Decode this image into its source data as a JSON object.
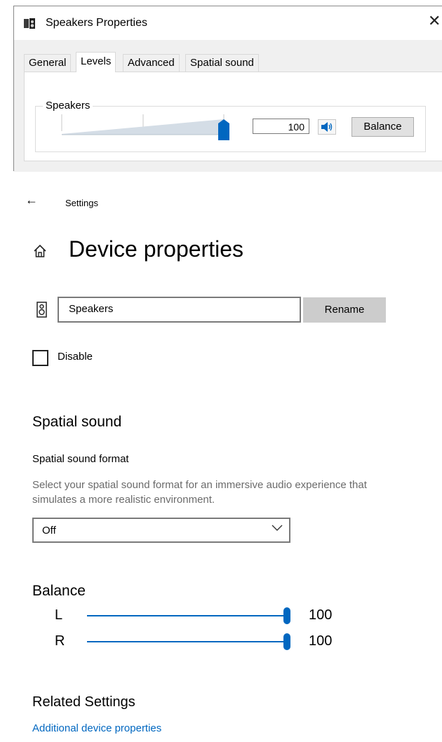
{
  "dialog": {
    "title": "Speakers Properties",
    "close_glyph": "✕",
    "tabs": [
      {
        "label": "General",
        "active": false
      },
      {
        "label": "Levels",
        "active": true
      },
      {
        "label": "Advanced",
        "active": false
      },
      {
        "label": "Spatial sound",
        "active": false
      }
    ],
    "levels": {
      "group_label": "Speakers",
      "volume_value": "100",
      "volume_level_percent": 100,
      "mute_icon": "speaker-icon",
      "balance_button": "Balance"
    },
    "accent_color": "#0067c0"
  },
  "settings": {
    "app_title": "Settings",
    "back_icon": "back-arrow-icon",
    "home_icon": "home-icon",
    "page_title": "Device properties",
    "device_name": "Speakers",
    "rename_button": "Rename",
    "disable_label": "Disable",
    "disable_checked": false,
    "spatial_heading": "Spatial sound",
    "spatial_format_label": "Spatial sound format",
    "spatial_desc_line1": "Select your spatial sound format for an immersive audio experience that",
    "spatial_desc_line2": "simulates a more realistic environment.",
    "spatial_format_value": "Off",
    "balance_heading": "Balance",
    "balance": {
      "left_label": "L",
      "left_value": "100",
      "right_label": "R",
      "right_value": "100"
    },
    "related_heading": "Related Settings",
    "related_link": "Additional device properties",
    "link_color": "#0067c0"
  }
}
